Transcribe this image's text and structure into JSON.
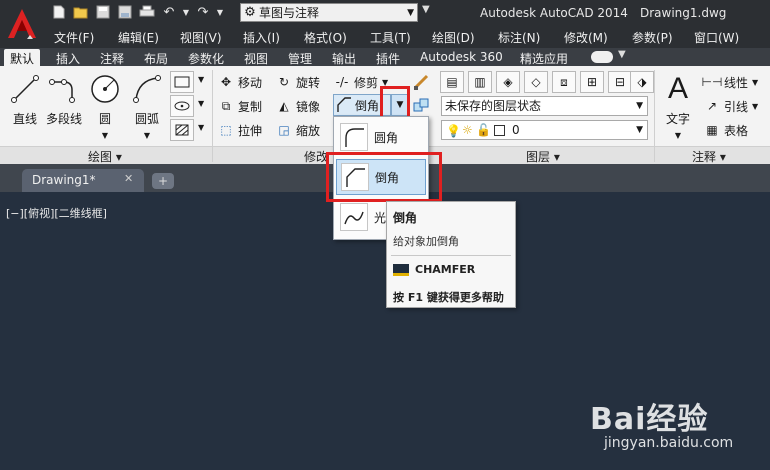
{
  "titlebar": {
    "app_title": "Autodesk AutoCAD 2014",
    "doc_title": "Drawing1.dwg",
    "workspace": "草图与注释",
    "quick_access_icons": [
      "new-icon",
      "open-icon",
      "save-icon",
      "save-as-icon",
      "print-icon",
      "undo-icon",
      "redo-icon"
    ]
  },
  "menubar": {
    "items": [
      "文件(F)",
      "编辑(E)",
      "视图(V)",
      "插入(I)",
      "格式(O)",
      "工具(T)",
      "绘图(D)",
      "标注(N)",
      "修改(M)",
      "参数(P)",
      "窗口(W)"
    ]
  },
  "ribbon_tabs": {
    "items": [
      "默认",
      "插入",
      "注释",
      "布局",
      "参数化",
      "视图",
      "管理",
      "输出",
      "插件",
      "Autodesk 360",
      "精选应用"
    ],
    "active": "默认"
  },
  "ribbon": {
    "draw": {
      "title": "绘图",
      "tools": [
        "直线",
        "多段线",
        "圆",
        "圆弧"
      ]
    },
    "modify": {
      "title": "修改",
      "tools": {
        "move": "移动",
        "rotate": "旋转",
        "trim": "修剪",
        "copy": "复制",
        "mirror": "镜像",
        "chamfer": "倒角",
        "stretch": "拉伸",
        "scale": "缩放"
      }
    },
    "layers": {
      "title": "图层",
      "layer_state": "未保存的图层状态",
      "current_layer": "0"
    },
    "annotation": {
      "title": "注释",
      "text": "文字",
      "linear": "线性",
      "leader": "引线",
      "table": "表格"
    }
  },
  "doc_tab": {
    "label": "Drawing1*"
  },
  "viewport_label": "[−][俯视][二维线框]",
  "dropdown": {
    "items": [
      "圆角",
      "倒角",
      "光"
    ]
  },
  "tooltip": {
    "title": "倒角",
    "description": "给对象加倒角",
    "command": "CHAMFER",
    "help": "按 F1 键获得更多帮助"
  },
  "watermark": {
    "brand": "Bai经验",
    "url": "jingyan.baidu.com"
  },
  "colors": {
    "titlebar": "#2c2f33",
    "ribbon": "#f3f3f3",
    "canvas": "#25303f",
    "highlight_red": "#e02020",
    "selected_item": "#cde4f7"
  }
}
